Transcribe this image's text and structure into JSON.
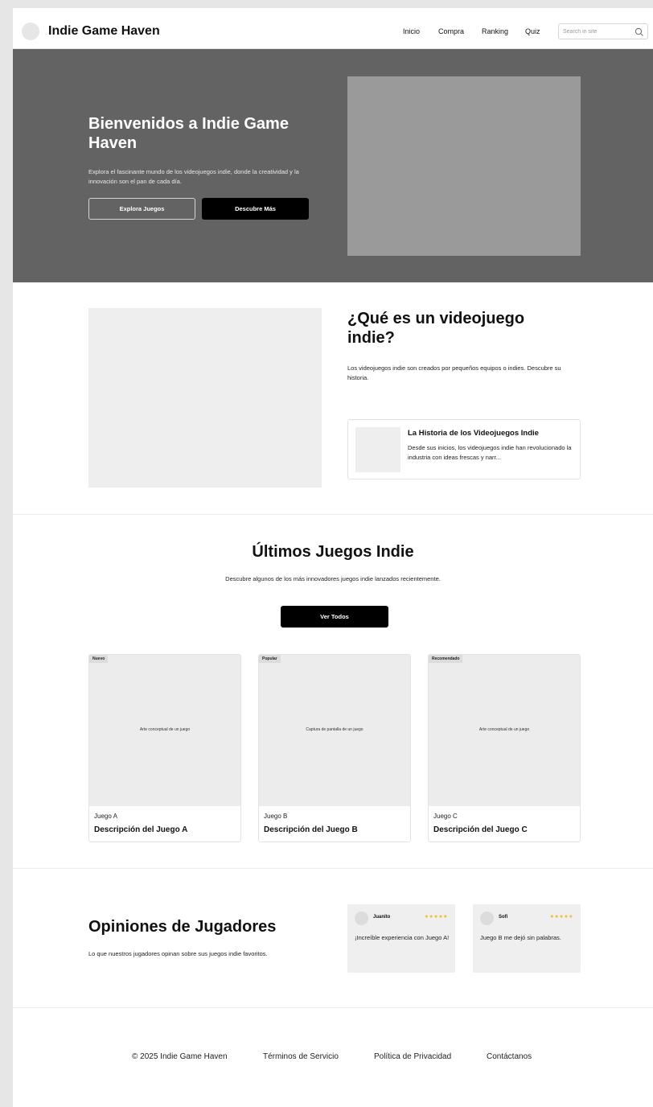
{
  "header": {
    "brand": "Indie Game Haven",
    "nav": [
      "Inicio",
      "Compra",
      "Ranking",
      "Quiz"
    ],
    "search_placeholder": "Search in site"
  },
  "hero": {
    "title": "Bienvenidos a Indie Game Haven",
    "text": "Explora el fascinante mundo de los videojuegos indie, donde la creatividad y la innovación son el pan de cada día.",
    "primary_button": "Explora Juegos",
    "secondary_button": "Descubre Más"
  },
  "about": {
    "title": "¿Qué es un videojuego indie?",
    "text": "Los videojuegos indie son creados por pequeños equipos o indies. Descubre su historia.",
    "card_title": "La Historia de los Videojuegos Indie",
    "card_text": "Desde sus inicios, los videojuegos indie han revolucionado la industria con ideas frescas y narr..."
  },
  "latest": {
    "title": "Últimos Juegos Indie",
    "text": "Descubre algunos de los más innovadores juegos indie lanzados recientemente.",
    "button": "Ver Todos",
    "games": [
      {
        "badge": "Nuevo",
        "caption": "Arte conceptual de un juego",
        "name": "Juego A",
        "desc": "Descripción del Juego A"
      },
      {
        "badge": "Popular",
        "caption": "Captura de pantalla de un juego",
        "name": "Juego B",
        "desc": "Descripción del Juego B"
      },
      {
        "badge": "Recomendado",
        "caption": "Arte conceptual de un juego",
        "name": "Juego C",
        "desc": "Descripción del Juego C"
      }
    ]
  },
  "reviews": {
    "title": "Opiniones de Jugadores",
    "text": "Lo que nuestros jugadores opinan sobre sus juegos indie favoritos.",
    "items": [
      {
        "name": "Juanito",
        "stars": "★★★★★",
        "text": "¡Increíble experiencia con Juego A!"
      },
      {
        "name": "Sofi",
        "stars": "★★★★★",
        "text": "Juego B me dejó sin palabras."
      }
    ]
  },
  "footer": {
    "copyright": "© 2025 Indie Game Haven",
    "links": [
      "Términos de Servicio",
      "Política de Privacidad",
      "Contáctanos"
    ]
  },
  "colors": {
    "hero_bg": "#636363",
    "hero_image": "#9a9a9a",
    "placeholder": "#eeeeee",
    "primary_button": "#000000",
    "star": "#f2b51d"
  }
}
